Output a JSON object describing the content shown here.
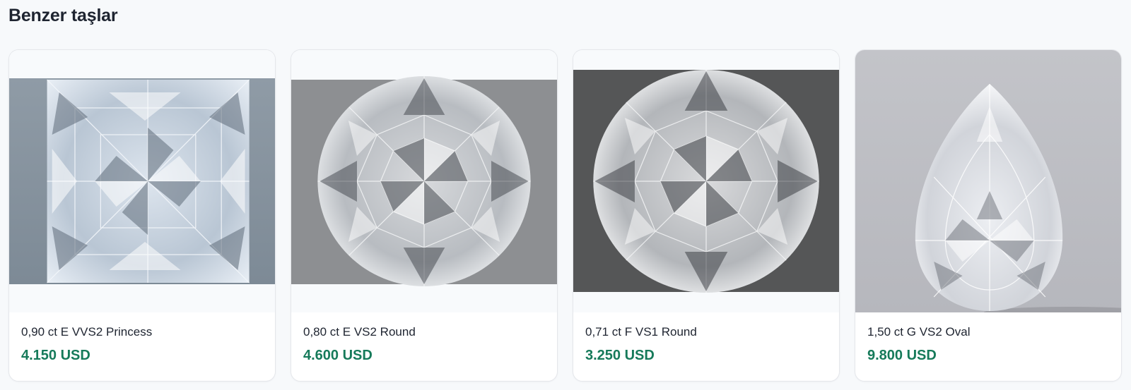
{
  "section": {
    "title": "Benzer taşlar"
  },
  "cards": [
    {
      "title": "0,90 ct E VVS2 Princess",
      "price": "4.150 USD",
      "shape": "princess"
    },
    {
      "title": "0,80 ct E VS2 Round",
      "price": "4.600 USD",
      "shape": "round"
    },
    {
      "title": "0,71 ct F VS1 Round",
      "price": "3.250 USD",
      "shape": "round"
    },
    {
      "title": "1,50 ct G VS2 Oval",
      "price": "9.800 USD",
      "shape": "pear"
    }
  ],
  "colors": {
    "price": "#167a5a",
    "page_background": "#f7f9fb",
    "card_border": "#e5e7eb"
  }
}
